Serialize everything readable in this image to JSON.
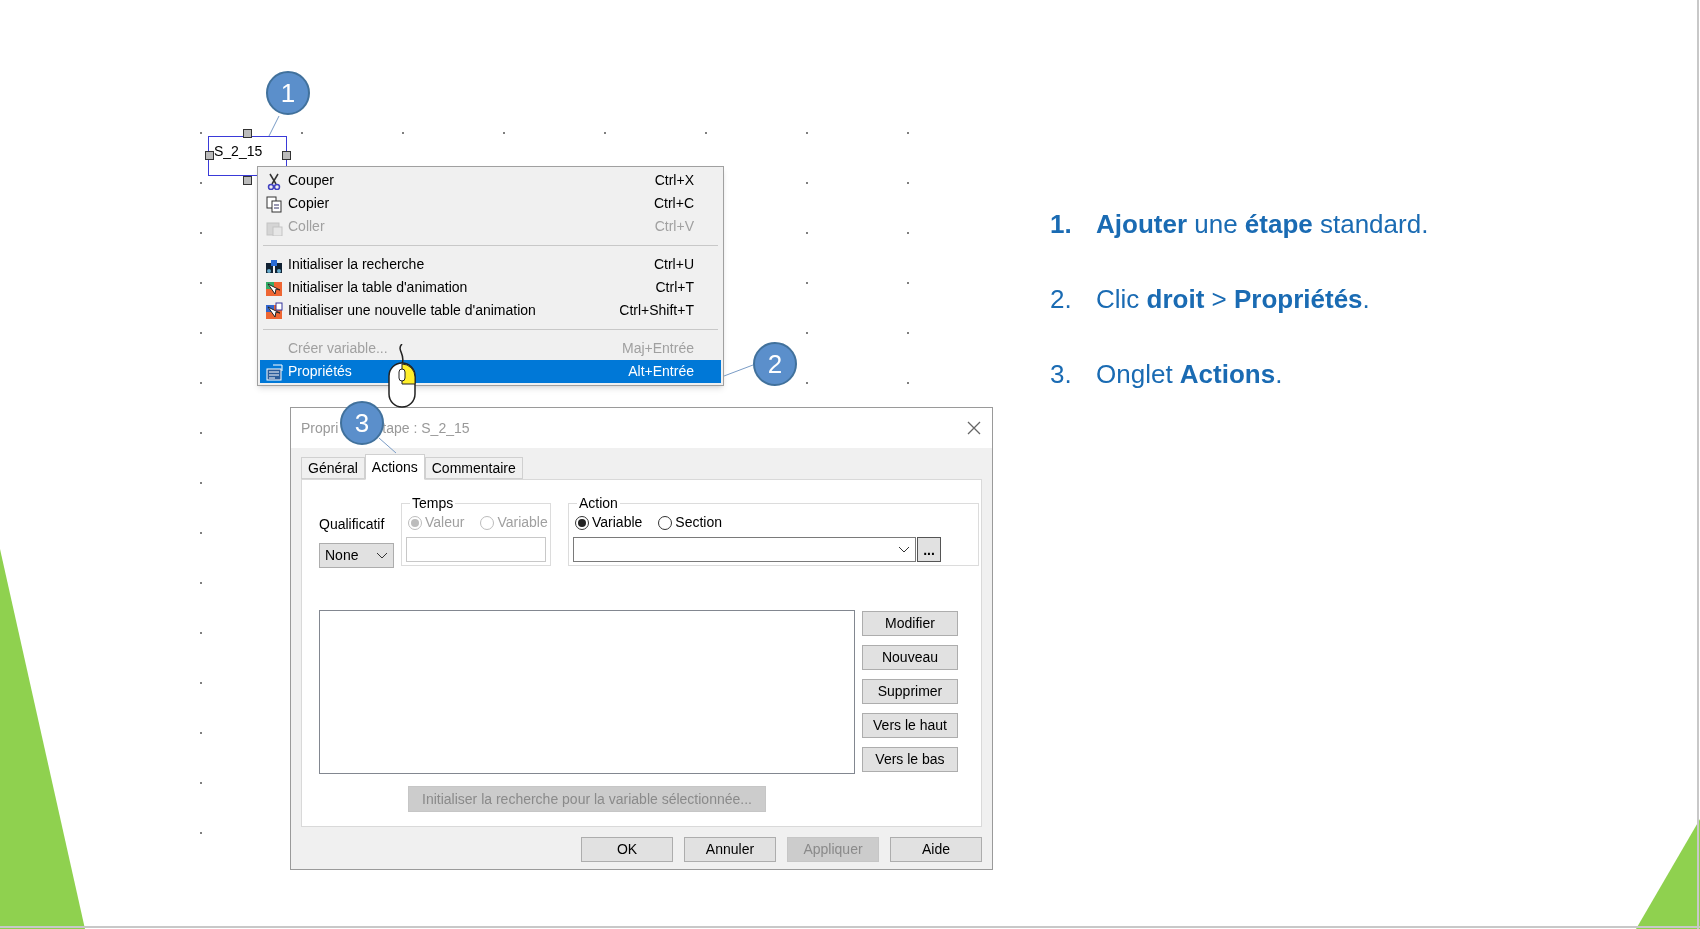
{
  "step_box": {
    "label": "S_2_15"
  },
  "callouts": [
    "1",
    "2",
    "3"
  ],
  "context_menu": {
    "items": [
      {
        "kind": "item",
        "label": "Couper",
        "shortcut": "Ctrl+X",
        "disabled": false,
        "selected": false
      },
      {
        "kind": "item",
        "label": "Copier",
        "shortcut": "Ctrl+C",
        "disabled": false,
        "selected": false
      },
      {
        "kind": "item",
        "label": "Coller",
        "shortcut": "Ctrl+V",
        "disabled": true,
        "selected": false
      },
      {
        "kind": "separator"
      },
      {
        "kind": "item",
        "label": "Initialiser la recherche",
        "shortcut": "Ctrl+U",
        "disabled": false,
        "selected": false
      },
      {
        "kind": "item",
        "label": "Initialiser la table d'animation",
        "shortcut": "Ctrl+T",
        "disabled": false,
        "selected": false
      },
      {
        "kind": "item",
        "label": "Initialiser une nouvelle table d'animation",
        "shortcut": "Ctrl+Shift+T",
        "disabled": false,
        "selected": false
      },
      {
        "kind": "separator"
      },
      {
        "kind": "item",
        "label": "Créer variable...",
        "shortcut": "Maj+Entrée",
        "disabled": true,
        "selected": false
      },
      {
        "kind": "item",
        "label": "Propriétés",
        "shortcut": "Alt+Entrée",
        "disabled": false,
        "selected": true
      }
    ]
  },
  "dialog": {
    "title_start": "Propri",
    "title_end": "tape : S_2_15",
    "tabs": [
      {
        "label": "Général",
        "selected": false
      },
      {
        "label": "Actions",
        "selected": true
      },
      {
        "label": "Commentaire",
        "selected": false
      }
    ],
    "qualificatif": {
      "label": "Qualificatif",
      "value": "None"
    },
    "temps": {
      "legend": "Temps",
      "options": [
        {
          "label": "Valeur",
          "selected": true,
          "disabled": true
        },
        {
          "label": "Variable",
          "selected": false,
          "disabled": true
        }
      ]
    },
    "action": {
      "legend": "Action",
      "options": [
        {
          "label": "Variable",
          "selected": true,
          "disabled": false
        },
        {
          "label": "Section",
          "selected": false,
          "disabled": false
        }
      ],
      "browse": "..."
    },
    "side_buttons": [
      {
        "label": "Modifier",
        "disabled": false
      },
      {
        "label": "Nouveau",
        "disabled": false
      },
      {
        "label": "Supprimer",
        "disabled": false
      },
      {
        "label": "Vers le haut",
        "disabled": false
      },
      {
        "label": "Vers le bas",
        "disabled": false
      }
    ],
    "search_button": {
      "label": "Initialiser la recherche pour la variable sélectionnée...",
      "disabled": true
    },
    "footer_buttons": [
      {
        "label": "OK",
        "disabled": false
      },
      {
        "label": "Annuler",
        "disabled": false
      },
      {
        "label": "Appliquer",
        "disabled": true
      },
      {
        "label": "Aide",
        "disabled": false
      }
    ]
  },
  "steps": [
    {
      "number": "1.",
      "current": true,
      "text": "**Ajouter** une **étape** standard."
    },
    {
      "number": "2.",
      "current": false,
      "text": "Clic **droit** > **Propriétés**."
    },
    {
      "number": "3.",
      "current": false,
      "text": "Onglet **Actions**."
    }
  ]
}
